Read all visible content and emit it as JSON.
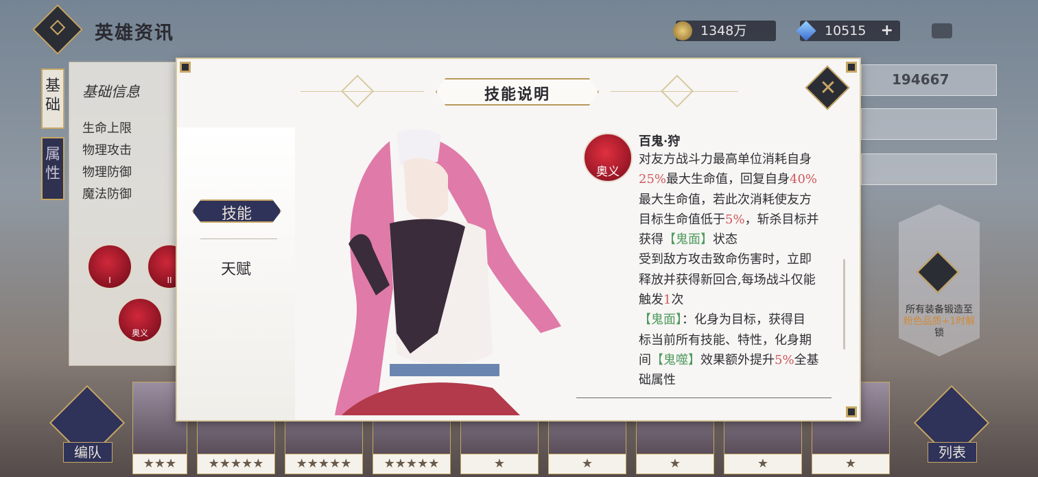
{
  "header": {
    "title": "英雄资讯"
  },
  "currency": {
    "gold": "1348万",
    "gems": "10515",
    "gems_plus": "+"
  },
  "side_tabs": {
    "basic": "基础",
    "attributes": "属性"
  },
  "basic_info": {
    "heading": "基础信息",
    "stats": [
      "生命上限",
      "物理攻击",
      "物理防御",
      "魔法防御"
    ]
  },
  "skills_bg": {
    "orb_labels": [
      "I",
      "II",
      "奥义"
    ]
  },
  "power": {
    "value": "194667"
  },
  "lock_card": {
    "text": "所有装备锻造至",
    "text2": "粉色品质+1时解",
    "text3": "锁"
  },
  "bottom": {
    "team_label": "编队",
    "list_label": "列表",
    "stars": [
      "★★★",
      "★★★★★",
      "★★★★★",
      "★★★★★",
      "★",
      "★",
      "★",
      "★",
      "★"
    ]
  },
  "modal": {
    "title": "技能说明",
    "close": "✕",
    "tabs": {
      "skill": "技能",
      "talent": "天赋"
    },
    "skill": {
      "icon_tag": "奥义",
      "name": "百鬼·狩",
      "lines": [
        [
          {
            "t": "对友方战斗力最高单位消耗自身"
          }
        ],
        [
          {
            "t": "25%",
            "c": "hl"
          },
          {
            "t": "最大生命值，回复自身"
          },
          {
            "t": "40%",
            "c": "hl"
          }
        ],
        [
          {
            "t": "最大生命值，若此次消耗使友方"
          }
        ],
        [
          {
            "t": "目标生命值低于"
          },
          {
            "t": "5%",
            "c": "hl"
          },
          {
            "t": "，斩杀目标并"
          }
        ],
        [
          {
            "t": "获得"
          },
          {
            "t": "【鬼面】",
            "c": "gr"
          },
          {
            "t": "状态"
          }
        ],
        [
          {
            "t": "受到敌方攻击致命伤害时，立即"
          }
        ],
        [
          {
            "t": "释放并获得新回合,每场战斗仅能"
          }
        ],
        [
          {
            "t": "触发"
          },
          {
            "t": "1",
            "c": "hl"
          },
          {
            "t": "次"
          }
        ],
        [
          {
            "t": "【鬼面】",
            "c": "gr"
          },
          {
            "t": "：化身为目标，获得目"
          }
        ],
        [
          {
            "t": "标当前所有技能、特性，化身期"
          }
        ],
        [
          {
            "t": "间"
          },
          {
            "t": "【鬼噬】",
            "c": "gr"
          },
          {
            "t": "效果额外提升"
          },
          {
            "t": "5%",
            "c": "hl"
          },
          {
            "t": "全基"
          }
        ],
        [
          {
            "t": "础属性"
          }
        ]
      ]
    }
  },
  "colors": {
    "highlight": "#d0565c",
    "green": "#4f9a5e",
    "navy": "#2f3259",
    "gold": "#c9a865"
  }
}
